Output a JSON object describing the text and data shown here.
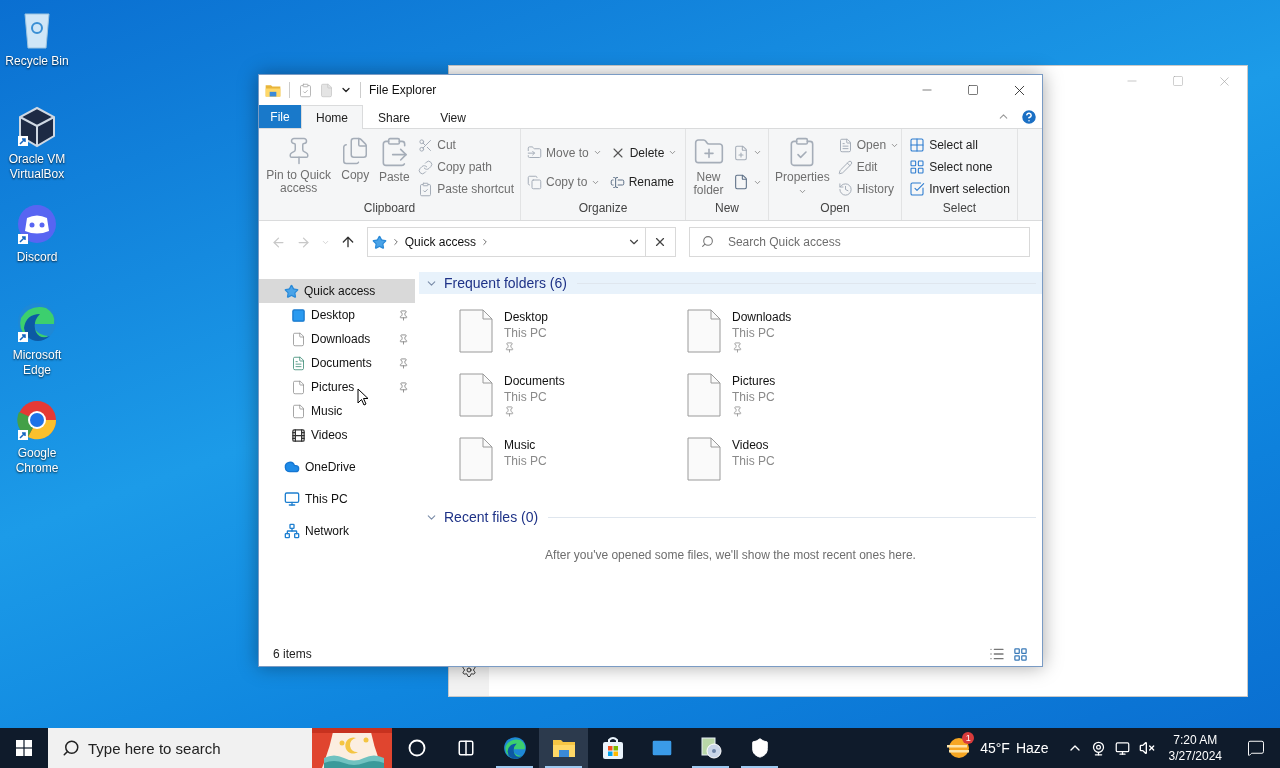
{
  "desktop_icons": [
    {
      "kind": "bin",
      "label": "Recycle Bin",
      "shortcut": false
    },
    {
      "kind": "virtualbox",
      "label": "Oracle VM VirtualBox",
      "shortcut": true
    },
    {
      "kind": "discord",
      "label": "Discord",
      "shortcut": true
    },
    {
      "kind": "edge",
      "label": "Microsoft Edge",
      "shortcut": true
    },
    {
      "kind": "chrome",
      "label": "Google Chrome",
      "shortcut": true
    }
  ],
  "explorer": {
    "title": "File Explorer",
    "tabs": [
      {
        "kind": "file",
        "label": "File",
        "selected": false
      },
      {
        "kind": "tab",
        "label": "Home",
        "selected": true
      },
      {
        "kind": "tab",
        "label": "Share",
        "selected": false
      },
      {
        "kind": "tab",
        "label": "View",
        "selected": false
      }
    ],
    "ribbon": {
      "groups": [
        {
          "label": "Clipboard",
          "blocks": [
            {
              "kind": "large",
              "label": "Pin to Quick access",
              "disabled": true
            },
            {
              "kind": "large",
              "label": "Copy",
              "disabled": true
            },
            {
              "kind": "large",
              "label": "Paste",
              "disabled": true
            },
            {
              "kind": "stack",
              "items": [
                {
                  "label": "Cut",
                  "disabled": true
                },
                {
                  "label": "Copy path",
                  "disabled": true
                },
                {
                  "label": "Paste shortcut",
                  "disabled": true
                }
              ]
            }
          ]
        },
        {
          "label": "Organize",
          "blocks": [
            {
              "kind": "stack",
              "items": [
                {
                  "label": "Move to",
                  "disabled": true,
                  "dropdown": true
                },
                {
                  "label": "Copy to",
                  "disabled": true,
                  "dropdown": true
                }
              ]
            },
            {
              "kind": "stack",
              "items": [
                {
                  "label": "Delete",
                  "disabled": false,
                  "dropdown": true
                },
                {
                  "label": "Rename",
                  "disabled": false
                }
              ]
            }
          ]
        },
        {
          "label": "New",
          "blocks": [
            {
              "kind": "large",
              "label": "New folder",
              "disabled": true
            },
            {
              "kind": "stack",
              "items": [
                {
                  "disabled": true,
                  "dropdown": true
                },
                {
                  "disabled": false,
                  "dropdown": true
                }
              ]
            }
          ]
        },
        {
          "label": "Open",
          "blocks": [
            {
              "kind": "large",
              "label": "Properties",
              "disabled": true,
              "dropdown": true
            },
            {
              "kind": "stack",
              "items": [
                {
                  "label": "Open",
                  "disabled": true,
                  "dropdown": true
                },
                {
                  "label": "Edit",
                  "disabled": true
                },
                {
                  "label": "History",
                  "disabled": true
                }
              ]
            }
          ]
        },
        {
          "label": "Select",
          "blocks": [
            {
              "kind": "stack",
              "items": [
                {
                  "label": "Select all",
                  "disabled": false
                },
                {
                  "label": "Select none",
                  "disabled": false
                },
                {
                  "label": "Invert selection",
                  "disabled": false
                }
              ]
            }
          ]
        }
      ]
    },
    "address": {
      "path": [
        "Quick access"
      ],
      "search_placeholder": "Search Quick access"
    },
    "nav_pane": [
      {
        "kind": "quick",
        "label": "Quick access",
        "selected": true,
        "children": [
          {
            "kind": "desktop",
            "label": "Desktop",
            "pinned": true,
            "selected": false
          },
          {
            "kind": "file",
            "label": "Downloads",
            "pinned": true,
            "selected": false
          },
          {
            "kind": "documents",
            "label": "Documents",
            "pinned": true,
            "selected": false
          },
          {
            "kind": "file",
            "label": "Pictures",
            "pinned": true,
            "selected": false
          },
          {
            "kind": "file",
            "label": "Music",
            "pinned": false,
            "selected": false
          },
          {
            "kind": "videos",
            "label": "Videos",
            "pinned": false,
            "selected": false
          }
        ]
      },
      {
        "kind": "cloud",
        "label": "OneDrive",
        "selected": false
      },
      {
        "kind": "pc",
        "label": "This PC",
        "selected": false
      },
      {
        "kind": "network",
        "label": "Network",
        "selected": false
      }
    ],
    "sections": [
      {
        "title": "Frequent folders (6)",
        "expanded": true,
        "hovered": true,
        "items": [
          {
            "name": "Desktop",
            "location": "This PC",
            "pinned": true
          },
          {
            "name": "Downloads",
            "location": "This PC",
            "pinned": true
          },
          {
            "name": "Documents",
            "location": "This PC",
            "pinned": true
          },
          {
            "name": "Pictures",
            "location": "This PC",
            "pinned": true
          },
          {
            "name": "Music",
            "location": "This PC",
            "pinned": false
          },
          {
            "name": "Videos",
            "location": "This PC",
            "pinned": false
          }
        ]
      },
      {
        "title": "Recent files (0)",
        "expanded": true,
        "hovered": false,
        "message": "After you've opened some files, we'll show the most recent ones here."
      }
    ],
    "status": "6 items"
  },
  "taskbar": {
    "search_placeholder": "Type here to search",
    "apps": [
      {
        "kind": "edge",
        "running": true,
        "active": false
      },
      {
        "kind": "explorer",
        "running": true,
        "active": true
      },
      {
        "kind": "store",
        "running": false,
        "active": false
      },
      {
        "kind": "mail",
        "running": false,
        "active": false
      },
      {
        "kind": "app",
        "running": true,
        "active": false
      },
      {
        "kind": "security",
        "running": true,
        "active": false
      }
    ],
    "weather": {
      "badge": "1",
      "temperature": "45°F",
      "condition": "Haze"
    },
    "time": "7:20 AM",
    "date": "3/27/2024"
  }
}
